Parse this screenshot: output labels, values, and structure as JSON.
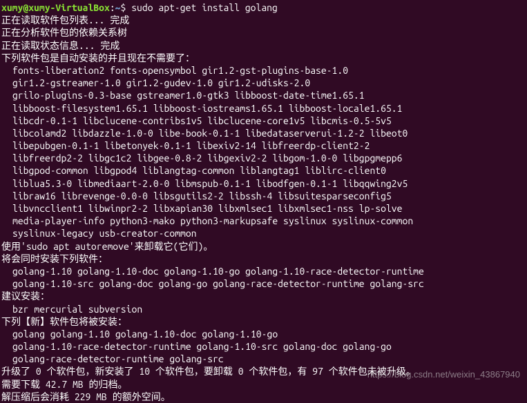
{
  "prompt": {
    "user_host": "xumy@xumy-VirtualBox",
    "colon": ":",
    "path": "~",
    "dollar": "$ ",
    "command": "sudo apt-get install golang"
  },
  "lines": {
    "reading_package_lists": "正在读取软件包列表... 完成",
    "building_dep_tree": "正在分析软件包的依赖关系树",
    "reading_state": "正在读取状态信息... 完成",
    "auto_installed_header": "下列软件包是自动安装的并且现在不需要了：",
    "pkg1": "fonts-liberation2 fonts-opensymbol gir1.2-gst-plugins-base-1.0",
    "pkg2": "gir1.2-gstreamer-1.0 gir1.2-gudev-1.0 gir1.2-udisks-2.0",
    "pkg3": "grilo-plugins-0.3-base gstreamer1.0-gtk3 libboost-date-time1.65.1",
    "pkg4": "libboost-filesystem1.65.1 libboost-iostreams1.65.1 libboost-locale1.65.1",
    "pkg5": "libcdr-0.1-1 libclucene-contribs1v5 libclucene-core1v5 libcmis-0.5-5v5",
    "pkg6": "libcolamd2 libdazzle-1.0-0 libe-book-0.1-1 libedataserverui-1.2-2 libeot0",
    "pkg7": "libepubgen-0.1-1 libetonyek-0.1-1 libexiv2-14 libfreerdp-client2-2",
    "pkg8": "libfreerdp2-2 libgc1c2 libgee-0.8-2 libgexiv2-2 libgom-1.0-0 libgpgmepp6",
    "pkg9": "libgpod-common libgpod4 liblangtag-common liblangtag1 liblirc-client0",
    "pkg10": "liblua5.3-0 libmediaart-2.0-0 libmspub-0.1-1 libodfgen-0.1-1 libqqwing2v5",
    "pkg11": "libraw16 librevenge-0.0-0 libsgutils2-2 libssh-4 libsuitesparseconfig5",
    "pkg12": "libvncclient1 libwinpr2-2 libxapian30 libxmlsec1 libxmlsec1-nss lp-solve",
    "pkg13": "media-player-info python3-mako python3-markupsafe syslinux syslinux-common",
    "pkg14": "syslinux-legacy usb-creator-common",
    "autoremove_hint": "使用'sudo apt autoremove'来卸载它(它们)。",
    "extra_install_header": "将会同时安装下列软件：",
    "extra1": "golang-1.10 golang-1.10-doc golang-1.10-go golang-1.10-race-detector-runtime",
    "extra2": "golang-1.10-src golang-doc golang-go golang-race-detector-runtime golang-src",
    "suggested_header": "建议安装：",
    "suggested1": "bzr mercurial subversion",
    "new_header": "下列【新】软件包将被安装：",
    "new1": "golang golang-1.10 golang-1.10-doc golang-1.10-go",
    "new2": "golang-1.10-race-detector-runtime golang-1.10-src golang-doc golang-go",
    "new3": "golang-race-detector-runtime golang-src",
    "summary1": "升级了 0 个软件包，新安装了 10 个软件包，要卸载 0 个软件包，有 97 个软件包未被升级。",
    "summary2": "需要下载 42.7 MB 的归档。",
    "summary3": "解压缩后会消耗 229 MB 的额外空间。"
  },
  "watermark": "https://blog.csdn.net/weixin_43867940"
}
